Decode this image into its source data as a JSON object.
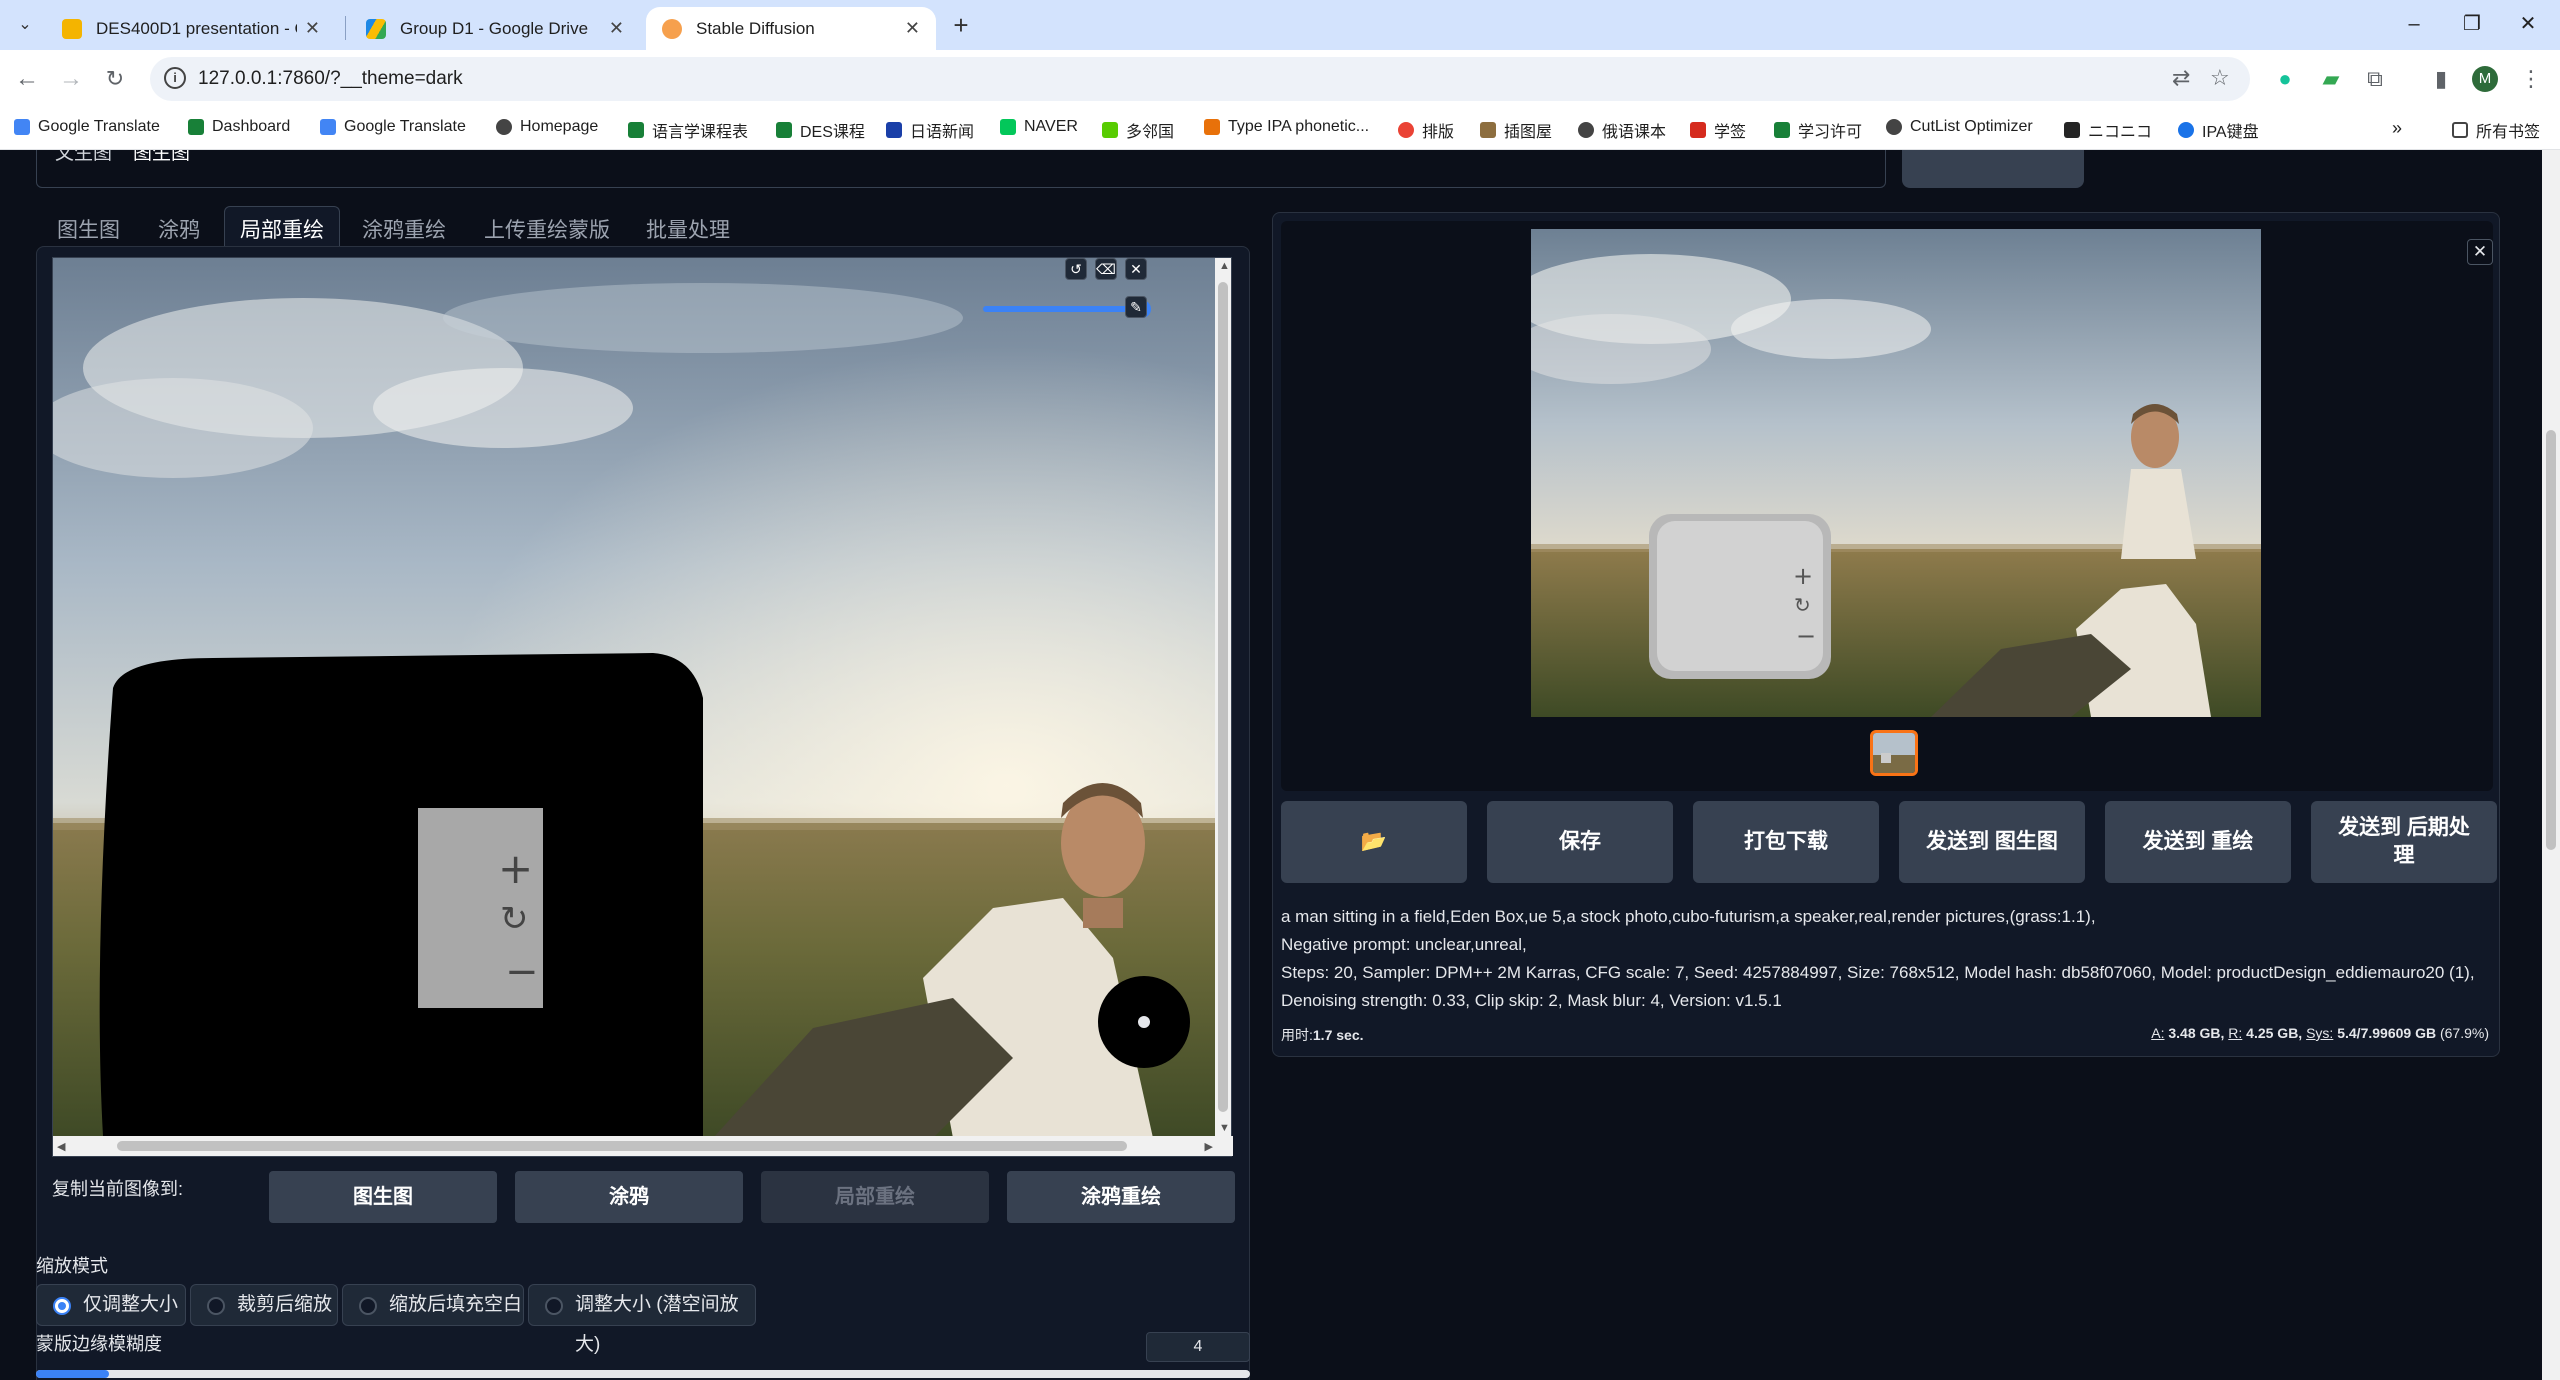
{
  "browser": {
    "tabs": [
      {
        "title": "DES400D1 presentation - Go",
        "favicon_color": "#f4b400"
      },
      {
        "title": "Group D1 - Google Drive",
        "favicon_color": "#1e88e5"
      },
      {
        "title": "Stable Diffusion",
        "favicon_color": "#f6a04d"
      }
    ],
    "url": "127.0.0.1:7860/?__theme=dark",
    "profile_initial": "M",
    "bookmarks": [
      "Google Translate",
      "Dashboard",
      "Google Translate",
      "Homepage",
      "语言学课程表",
      "DES课程",
      "日语新闻",
      "NAVER",
      "多邻国",
      "Type IPA phonetic...",
      "排版",
      "插图屋",
      "俄语课本",
      "学签",
      "学习许可",
      "CutList Optimizer",
      "ニコニコ",
      "IPA键盘"
    ],
    "bookmark_folder": "所有书签"
  },
  "app": {
    "top_tabs": [
      "文生图",
      "图生图"
    ],
    "sub_tabs": [
      "图生图",
      "涂鸦",
      "局部重绘",
      "涂鸦重绘",
      "上传重绘蒙版",
      "批量处理"
    ],
    "copy_label": "复制当前图像到:",
    "copy_buttons": [
      "图生图",
      "涂鸦",
      "局部重绘",
      "涂鸦重绘"
    ],
    "resize_mode_label": "缩放模式",
    "resize_modes": [
      "仅调整大小",
      "裁剪后缩放",
      "缩放后填充空白",
      "调整大小 (潜空间放大)"
    ],
    "mask_blur_label": "蒙版边缘模糊度",
    "mask_blur_value": "4",
    "mask_blur_fraction": 0.06,
    "output_buttons": [
      "📂",
      "保存",
      "打包下载",
      "发送到 图生图",
      "发送到 重绘",
      "发送到 后期处理"
    ],
    "gen_info": {
      "prompt": "a man sitting in a field,Eden Box,ue 5,a stock photo,cubo-futurism,a speaker,real,render pictures,(grass:1.1),",
      "negative": "Negative prompt: unclear,unreal,",
      "params": "Steps: 20, Sampler: DPM++ 2M Karras, CFG scale: 7, Seed: 4257884997, Size: 768x512, Model hash: db58f07060, Model: productDesign_eddiemauro20 (1), Denoising strength: 0.33, Clip skip: 2, Mask blur: 4, Version: v1.5.1"
    },
    "time_label": "用时:",
    "time_value": "1.7 sec.",
    "mem": {
      "a_label": "A:",
      "a_value": "3.48 GB,",
      "r_label": "R:",
      "r_value": "4.25 GB,",
      "sys_label": "Sys:",
      "sys_value": "5.4/7.99609 GB",
      "pct": "(67.9%)"
    }
  }
}
